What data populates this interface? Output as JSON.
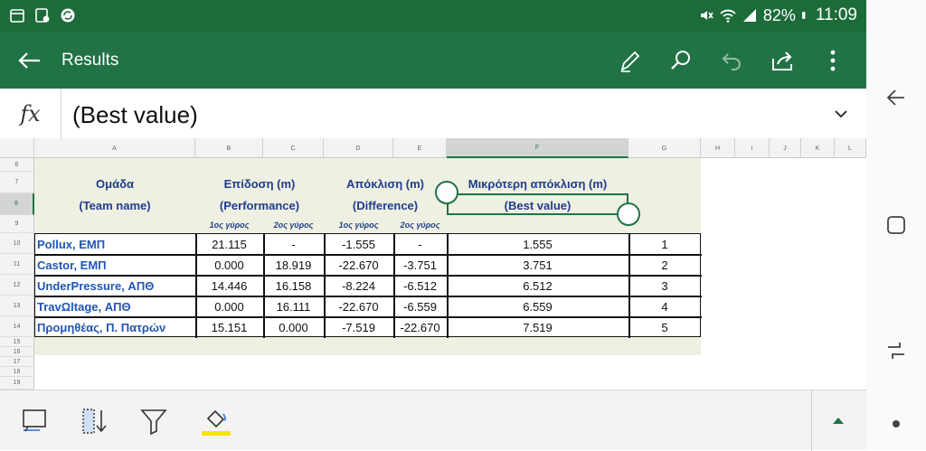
{
  "status": {
    "battery": "82%",
    "time": "11:09"
  },
  "appbar": {
    "title": "Results"
  },
  "formula": {
    "fx": "fx",
    "value": "(Best value)"
  },
  "columns": [
    "A",
    "B",
    "C",
    "D",
    "E",
    "F",
    "G",
    "H",
    "I",
    "J",
    "K",
    "L"
  ],
  "rows": [
    "6",
    "7",
    "8",
    "9",
    "10",
    "11",
    "12",
    "13",
    "14",
    "15",
    "16",
    "17",
    "18",
    "19"
  ],
  "sheet": {
    "h_team": "Ομάδα",
    "h_team_en": "(Team name)",
    "h_perf": "Επίδοση (m)",
    "h_perf_en": "(Performance)",
    "h_diff": "Απόκλιση (m)",
    "h_diff_en": "(Difference)",
    "h_best": "Μικρότερη απόκλιση (m)",
    "h_best_en": "(Best value)",
    "r1": "1ος γύρος",
    "r2": "2ος γύρος",
    "data": [
      {
        "team": "Pollux, ΕΜΠ",
        "p1": "21.115",
        "p2": "-",
        "d1": "-1.555",
        "d2": "-",
        "best": "1.555",
        "rank": "1"
      },
      {
        "team": "Castor, ΕΜΠ",
        "p1": "0.000",
        "p2": "18.919",
        "d1": "-22.670",
        "d2": "-3.751",
        "best": "3.751",
        "rank": "2"
      },
      {
        "team": "UnderPressure, ΑΠΘ",
        "p1": "14.446",
        "p2": "16.158",
        "d1": "-8.224",
        "d2": "-6.512",
        "best": "6.512",
        "rank": "3"
      },
      {
        "team": "TravΩltage, ΑΠΘ",
        "p1": "0.000",
        "p2": "16.111",
        "d1": "-22.670",
        "d2": "-6.559",
        "best": "6.559",
        "rank": "4"
      },
      {
        "team": "Προμηθέας, Π. Πατρών",
        "p1": "15.151",
        "p2": "0.000",
        "d1": "-7.519",
        "d2": "-22.670",
        "best": "7.519",
        "rank": "5"
      }
    ]
  },
  "colors": {
    "brand": "#217346",
    "status": "#1e6b3a",
    "header_text": "#1f3d8a",
    "team_text": "#1f56b5",
    "panel": "#eef0e1",
    "highlight": "#f4e600"
  }
}
